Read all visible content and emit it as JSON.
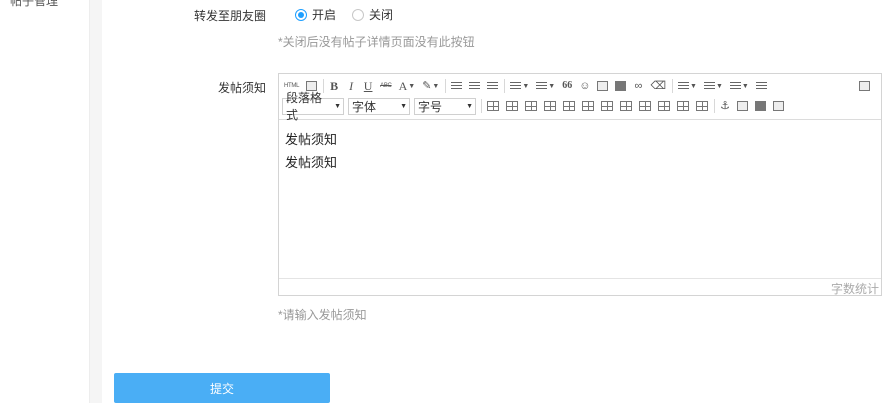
{
  "sidebar": {
    "cut_text": "帖子管理"
  },
  "share_setting": {
    "label": "转发至朋友圈",
    "options": [
      {
        "label": "开启",
        "checked": true
      },
      {
        "label": "关闭",
        "checked": false
      }
    ],
    "hint": "*关闭后没有帖子详情页面没有此按钮"
  },
  "post_notice": {
    "label": "发帖须知",
    "toolbar": {
      "html_label": "HTML",
      "bold": "B",
      "italic": "I",
      "underline": "U",
      "strike": "ABC",
      "font_color": "A",
      "quote": "66",
      "paragraph_select": "段落格式",
      "font_select": "字体",
      "size_select": "字号"
    },
    "content_lines": [
      "发帖须知",
      "发帖须知"
    ],
    "word_count_label": "字数统计",
    "hint": "*请输入发帖须知"
  },
  "submit": {
    "label": "提交"
  },
  "colors": {
    "accent": "#1e9fff",
    "button": "#4aaef5"
  }
}
